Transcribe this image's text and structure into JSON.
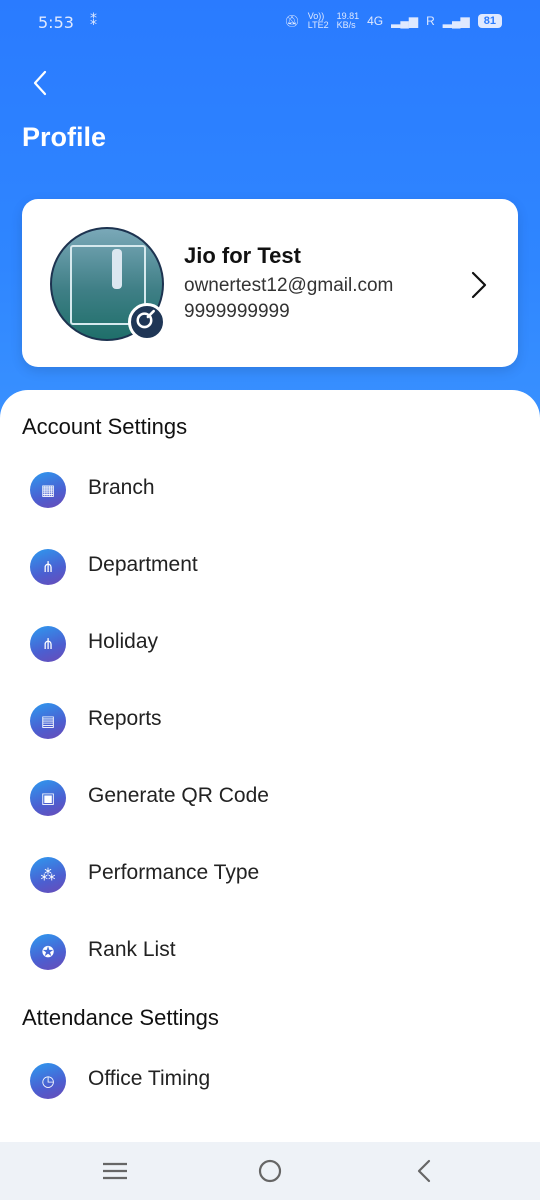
{
  "status_bar": {
    "time": "5:53",
    "network_top": "19.81",
    "network_bottom": "KB/s",
    "volte_top": "Vo))",
    "volte_bottom": "LTE2",
    "network_type": "4G",
    "roaming": "R",
    "battery": "81"
  },
  "header": {
    "title": "Profile"
  },
  "profile": {
    "name": "Jio for Test",
    "email": "ownertest12@gmail.com",
    "phone": "9999999999"
  },
  "sections": {
    "account_settings": "Account Settings",
    "attendance_settings": "Attendance Settings"
  },
  "account_items": [
    {
      "label": "Branch",
      "icon": "building-icon"
    },
    {
      "label": "Department",
      "icon": "org-chart-icon"
    },
    {
      "label": "Holiday",
      "icon": "org-chart-icon"
    },
    {
      "label": "Reports",
      "icon": "report-icon"
    },
    {
      "label": "Generate QR Code",
      "icon": "qr-code-icon"
    },
    {
      "label": "Performance Type",
      "icon": "team-icon"
    },
    {
      "label": "Rank List",
      "icon": "medal-icon"
    }
  ],
  "attendance_items": [
    {
      "label": "Office Timing",
      "icon": "clock-icon"
    }
  ],
  "colors": {
    "header_blue": "#2f86ff",
    "card_bg": "#ffffff",
    "icon_gradient_start": "#2d9bf0",
    "icon_gradient_end": "#6a4bb7"
  }
}
